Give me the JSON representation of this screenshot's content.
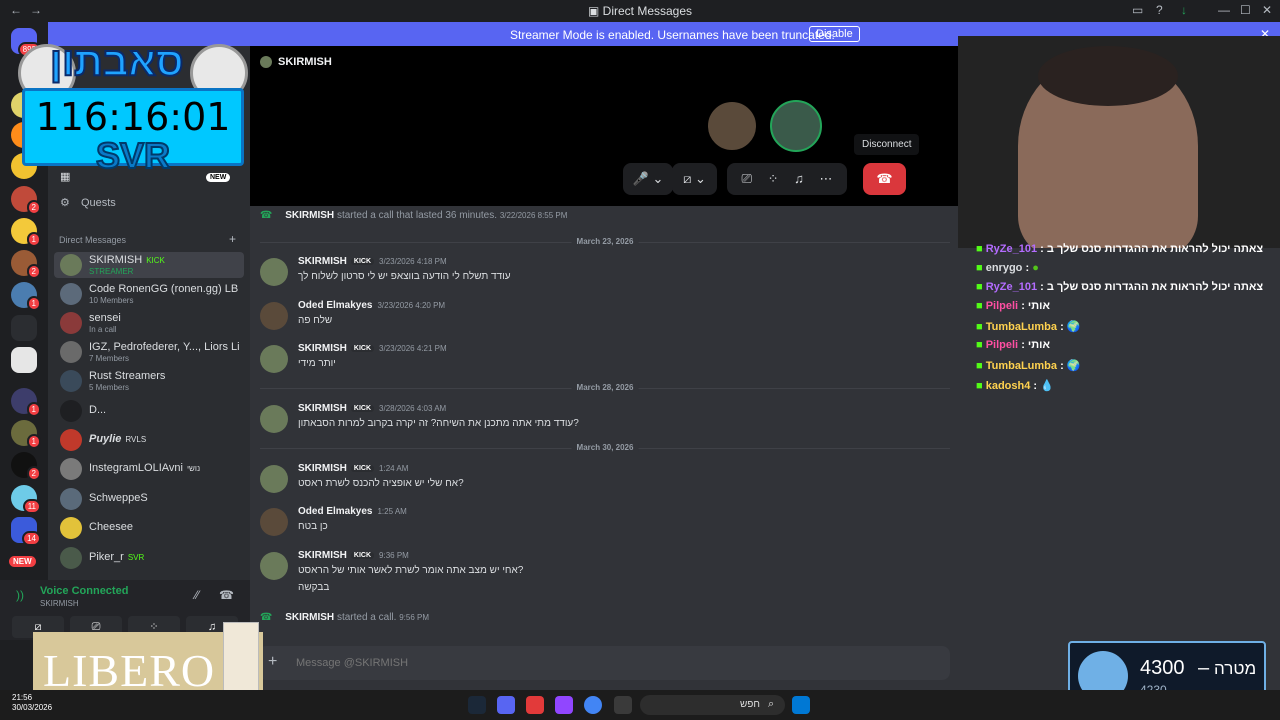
{
  "window": {
    "title": "Direct Messages"
  },
  "banner": {
    "text": "Streamer Mode is enabled. Usernames have been truncated.",
    "button": "Disable"
  },
  "rail": {
    "discord_badge": "893",
    "badges": [
      "2",
      "1",
      "2",
      "1",
      "1",
      "1",
      "2",
      "11",
      "14",
      "1",
      "1"
    ],
    "new_label": "NEW"
  },
  "sidebar": {
    "quests": "Quests",
    "new_badge": "NEW",
    "dm_header": "Direct Messages",
    "add_label": "+",
    "items": [
      {
        "name": "SKIRMISH",
        "tag": "KICK",
        "sub": "STREAMER"
      },
      {
        "name": "Code RonenGG (ronen.gg) LB, I...",
        "tag": "",
        "sub": "10 Members"
      },
      {
        "name": "sensei",
        "tag": "",
        "sub": "In a call"
      },
      {
        "name": "IGZ, Pedrofederer, Y..., Liors Lif...",
        "tag": "",
        "sub": "7 Members"
      },
      {
        "name": "Rust Streamers",
        "tag": "",
        "sub": "5 Members"
      },
      {
        "name": "D...",
        "tag": "",
        "sub": ""
      },
      {
        "name": "Puylie",
        "tag": "RVLS",
        "sub": ""
      },
      {
        "name": "InstegramLOLIAvni",
        "tag": "נושי",
        "sub": ""
      },
      {
        "name": "SchweppeS",
        "tag": "",
        "sub": ""
      },
      {
        "name": "Cheesee",
        "tag": "",
        "sub": ""
      },
      {
        "name": "Piker_r",
        "tag": "SVR",
        "sub": ""
      }
    ]
  },
  "voice": {
    "status": "Voice Connected",
    "channel": "SKIRMISH"
  },
  "call": {
    "header": "SKIRMISH",
    "tooltip": "Disconnect"
  },
  "chat": {
    "sys1": {
      "user": "SKIRMISH",
      "text": "started a call that lasted 36 minutes.",
      "time": "3/22/2026 8:55 PM"
    },
    "sep1": "March 23, 2026",
    "m1": {
      "author": "SKIRMISH",
      "tag": "KICK",
      "time": "3/23/2026 4:18 PM",
      "text": "עודד תשלח לי הודעה בווצאפ יש לי סרטון לשלוח לך"
    },
    "m2": {
      "author": "Oded Elmakyes",
      "time": "3/23/2026 4:20 PM",
      "text": "שלח פה"
    },
    "m3": {
      "author": "SKIRMISH",
      "tag": "KICK",
      "time": "3/23/2026 4:21 PM",
      "text": "יותר מידי"
    },
    "sep2": "March 28, 2026",
    "m4": {
      "author": "SKIRMISH",
      "tag": "KICK",
      "time": "3/28/2026 4:03 AM",
      "text": "עודד מתי אתה מתכנן את השיחה? זה יקרה בקרוב למרות הסבאתון?"
    },
    "sep3": "March 30, 2026",
    "m5": {
      "author": "SKIRMISH",
      "tag": "KICK",
      "time": "1:24 AM",
      "text": "אח שלי יש אופציה להכנס לשרת ראסט?"
    },
    "m6": {
      "author": "Oded Elmakyes",
      "time": "1:25 AM",
      "text": "כן בטח"
    },
    "m7": {
      "author": "SKIRMISH",
      "tag": "KICK",
      "time": "9:36 PM",
      "text": "אחי יש מצב אתה אומר לשרת לאשר אותי של הראסט?",
      "text2": "בבקשה"
    },
    "sys2": {
      "user": "SKIRMISH",
      "text": "started a call.",
      "time": "9:56 PM"
    }
  },
  "composer": {
    "placeholder": "Message @SKIRMISH"
  },
  "twitch": [
    {
      "user": "RyZe_101",
      "msg": ": צאתה יכול להראות את ההגדרות סנס שלך ב",
      "color": "#b46cff"
    },
    {
      "user": "enrygo",
      "msg": ":",
      "color": "#dbdee1"
    },
    {
      "user": "RyZe_101",
      "msg": ": צאתה יכול להראות את ההגדרות סנס שלך ב",
      "color": "#b46cff"
    },
    {
      "user": "Pilpeli",
      "msg": ": אותי",
      "color": "#ff4fa3"
    },
    {
      "user": "TumbaLumba",
      "msg": ":",
      "color": "#ffd24f"
    },
    {
      "user": "Pilpeli",
      "msg": ": אותי",
      "color": "#ff4fa3"
    },
    {
      "user": "TumbaLumba",
      "msg": ":",
      "color": "#ffd24f"
    },
    {
      "user": "kadosh4",
      "msg": ":",
      "color": "#ffd24f"
    }
  ],
  "overlay": {
    "logo_text": "סאבתון",
    "timer": "116:16:01",
    "timer_sub": "SVR",
    "ad_text": "LIBERO"
  },
  "goal": {
    "label": "מטרה",
    "target": "4300",
    "current": "4230"
  },
  "taskbar": {
    "search": "חפש",
    "clock_time": "21:56",
    "clock_date": "30/03/2026"
  },
  "colors": {
    "blurple": "#5865f2",
    "green": "#23a559",
    "red": "#da373c",
    "bg": "#313338",
    "sidebar": "#2b2d31"
  }
}
